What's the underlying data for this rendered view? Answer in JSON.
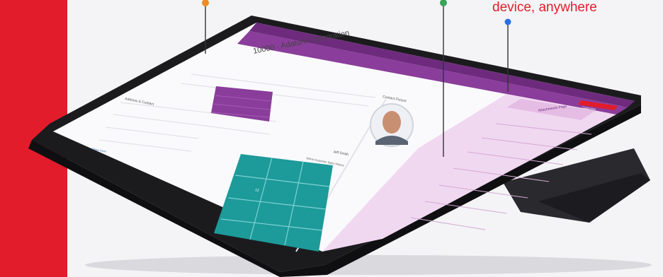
{
  "caption": "device, anywhere",
  "screen": {
    "record_title": "10000 · Adatum Corporation",
    "sections": {
      "address": "Address & Contact",
      "contact_picture": "Contact Picture",
      "factbox": "Sell-to Customer Sales History"
    },
    "side_panel": {
      "title": "Attachments Page",
      "badge": "Customize"
    },
    "contact_name": "Jeff Smith",
    "tile_count": "12",
    "show_more": "Show more"
  },
  "colors": {
    "brand_red": "#e31c2b",
    "purple_header": "#6e2b7d",
    "teal_tile": "#1d9a9a",
    "side_panel": "#f1d8f1",
    "pin_orange": "#f08a24",
    "pin_green": "#3aa35a",
    "pin_blue": "#2a6fe0"
  }
}
